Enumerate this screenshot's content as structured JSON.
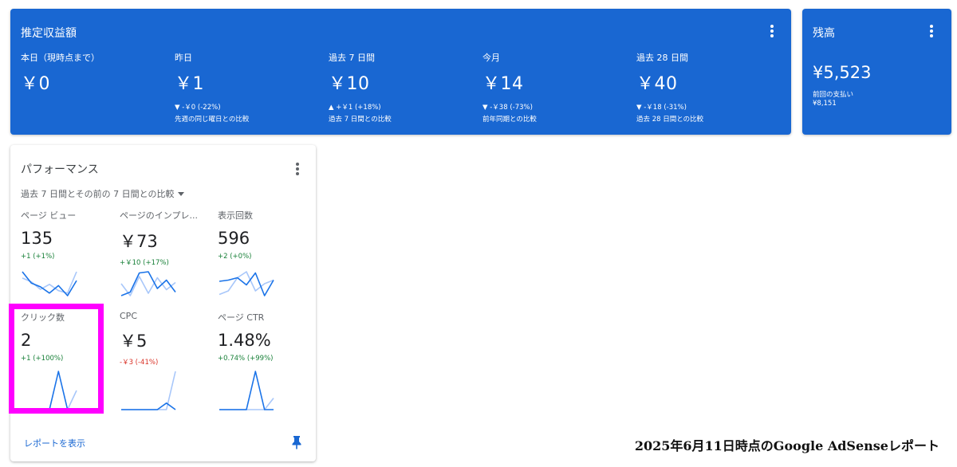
{
  "earnings": {
    "title": "推定収益額",
    "metrics": [
      {
        "label": "本日（現時点まで）",
        "value": "￥0",
        "change": "",
        "compare": ""
      },
      {
        "label": "昨日",
        "value": "￥1",
        "change": "▼ -￥0 (-22%)",
        "compare": "先週の同じ曜日との比較"
      },
      {
        "label": "過去 7 日間",
        "value": "￥10",
        "change": "▲ +￥1 (+18%)",
        "compare": "過去 7 日間との比較"
      },
      {
        "label": "今月",
        "value": "￥14",
        "change": "▼ -￥38 (-73%)",
        "compare": "前年同期との比較"
      },
      {
        "label": "過去 28 日間",
        "value": "￥40",
        "change": "▼ -￥18 (-31%)",
        "compare": "過去 28 日間との比較"
      }
    ]
  },
  "balance": {
    "title": "残高",
    "value": "¥5,523",
    "last_payment_label": "前回の支払い",
    "last_payment_value": "¥8,151"
  },
  "performance": {
    "title": "パフォーマンス",
    "comparison": "過去 7 日間とその前の 7 日間との比較",
    "tiles": [
      {
        "label": "ページ ビュー",
        "value": "135",
        "change": "+1 (+1%)",
        "trend": "positive",
        "current": [
          6,
          4.2,
          3.6,
          2.6,
          3.8,
          2.2,
          4.6
        ],
        "previous": [
          5,
          4.4,
          3.2,
          4.0,
          3.0,
          2.6,
          6
        ]
      },
      {
        "label": "ページのインプレ...",
        "value": "￥73",
        "change": "+￥10 (+17%)",
        "trend": "positive",
        "current": [
          1.0,
          1.6,
          4.8,
          5.0,
          2.2,
          3.6,
          1.6
        ],
        "previous": [
          3.0,
          1.0,
          4.2,
          1.4,
          4.0,
          2.0,
          3.2
        ]
      },
      {
        "label": "表示回数",
        "value": "596",
        "change": "+2 (+0%)",
        "trend": "positive",
        "current": [
          3.8,
          4.0,
          4.4,
          3.2,
          5.2,
          1.4,
          4.0
        ],
        "previous": [
          1.6,
          2.2,
          4.4,
          5.4,
          2.2,
          3.4,
          4.0
        ]
      },
      {
        "label": "クリック数",
        "value": "2",
        "change": "+1 (+100%)",
        "trend": "positive",
        "current": [
          0,
          0,
          0,
          0,
          1,
          0,
          0
        ],
        "previous": [
          0,
          0,
          0,
          0,
          0,
          0,
          0.5
        ]
      },
      {
        "label": "CPC",
        "value": "￥5",
        "change": "-￥3 (-41%)",
        "trend": "negative",
        "current": [
          0,
          0,
          0,
          0,
          0,
          0.12,
          0
        ],
        "previous": [
          0,
          0,
          0,
          0,
          0,
          0,
          0.7
        ]
      },
      {
        "label": "ページ CTR",
        "value": "1.48%",
        "change": "+0.74% (+99%)",
        "trend": "positive",
        "current": [
          0,
          0,
          0,
          0,
          1,
          0,
          0
        ],
        "previous": [
          0,
          0,
          0,
          0,
          0,
          0,
          0.3
        ]
      }
    ],
    "report_link": "レポートを表示"
  },
  "caption": "2025年6月11日時点のGoogle AdSenseレポート",
  "colors": {
    "header_blue": "#1967d2",
    "current_line": "#1a73e8",
    "previous_line": "#a8c7fa",
    "positive": "#188038",
    "negative": "#d93025",
    "highlight": "#ff00ff"
  }
}
